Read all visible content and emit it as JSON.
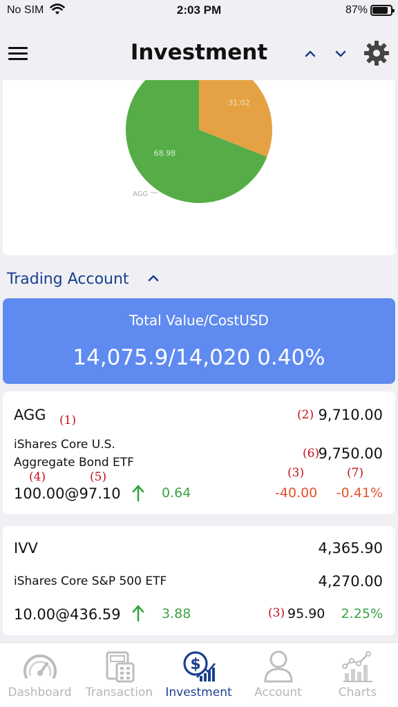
{
  "status_bar": {
    "carrier": "No SIM",
    "time": "2:03 PM",
    "battery": "87%",
    "battery_level": 0.87
  },
  "header": {
    "title": "Investment",
    "icons": [
      "menu-icon",
      "chevron-up-icon",
      "chevron-down-icon",
      "gear-icon"
    ]
  },
  "chart_data": {
    "type": "pie",
    "slices": [
      {
        "label": "",
        "value": 31.02,
        "color": "#e5a244"
      },
      {
        "label": "AGG",
        "value": 68.98,
        "color": "#56ad47"
      }
    ],
    "data_labels": [
      "31.02",
      "68.98"
    ],
    "outer_label": "AGG"
  },
  "section": {
    "title": "Trading Account"
  },
  "summary": {
    "label": "Total Value/CostUSD",
    "value": "14,075.9/14,020 0.40%"
  },
  "holdings": [
    {
      "symbol": "AGG",
      "name_line1": "iShares Core U.S.",
      "name_line2": "Aggregate Bond ETF",
      "market_value": "9,710.00",
      "cost": "9,750.00",
      "position": "100.00@97.10",
      "change": "0.64",
      "pnl": "-40.00",
      "pnl_pct": "-0.41%",
      "annotations": {
        "a1": "(1)",
        "a2": "(2)",
        "a3": "(3)",
        "a4": "(4)",
        "a5": "(5)",
        "a6": "(6)",
        "a7": "(7)"
      }
    },
    {
      "symbol": "IVV",
      "name": "iShares Core S&P 500 ETF",
      "market_value": "4,365.90",
      "cost": "4,270.00",
      "position": "10.00@436.59",
      "change": "3.88",
      "pnl": "95.90",
      "pnl_pct": "2.25%",
      "annotations": {
        "a3": "(3)"
      }
    }
  ],
  "tabbar": {
    "tabs": [
      {
        "label": "Dashboard",
        "icon": "speedometer-icon",
        "active": false
      },
      {
        "label": "Transaction",
        "icon": "calculator-icon",
        "active": false
      },
      {
        "label": "Investment",
        "icon": "dollar-growth-icon",
        "active": true
      },
      {
        "label": "Account",
        "icon": "person-icon",
        "active": false
      },
      {
        "label": "Charts",
        "icon": "bar-chart-icon",
        "active": false
      }
    ]
  },
  "colors": {
    "accent": "#1b3f8f",
    "summary_bg": "#5f8bf0",
    "positive": "#3aa244",
    "negative": "#e8502c",
    "annotation": "#c0101a"
  }
}
